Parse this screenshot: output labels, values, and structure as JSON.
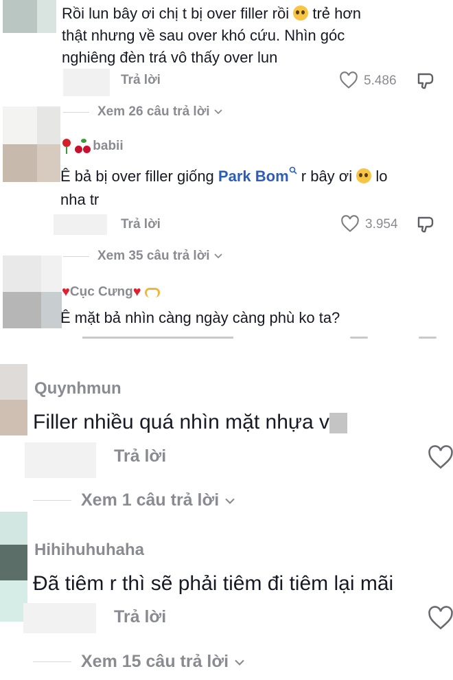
{
  "comments": [
    {
      "text": "Rồi lun bây ơi chị t bị over filler rồi 🥺 trẻ hơn thật nhưng về sau over khó cứu. Nhìn góc nghiêng đèn trá vô thấy over lun",
      "text_lines": [
        "Rồi lun bây ơi chị t bị over filler rồi",
        "trẻ hơn",
        "thật nhưng về sau over khó cứu. Nhìn góc",
        "nghiêng đèn trá vô thấy over lun"
      ],
      "reply_label": "Trả lời",
      "likes": "5.486",
      "view_replies": "Xem 26 câu trả lời"
    },
    {
      "username": "babii",
      "text_before_link": "Ê bả bị over filler giống",
      "link": "Park Bom",
      "text_after_link": "r bây ơi",
      "text_end": "lo",
      "text_line2": "nha tr",
      "reply_label": "Trả lời",
      "likes": "3.954",
      "view_replies": "Xem 35 câu trả lời"
    },
    {
      "username": "Cục Cưng",
      "text": "Ê mặt bả nhìn càng ngày càng phù ko ta?"
    },
    {
      "username": "Quynhmun",
      "text": "Filler nhiều quá nhìn mặt nhựa v",
      "reply_label": "Trả lời",
      "view_replies": "Xem 1 câu trả lời"
    },
    {
      "username": "Hihihuhuhaha",
      "text": "Đã tiêm r thì sẽ phải tiêm đi tiêm lại mãi",
      "reply_label": "Trả lời",
      "view_replies": "Xem 15 câu trả lời"
    }
  ],
  "icons": [
    "heart-icon",
    "dislike-icon",
    "chevron-down-icon",
    "search-icon",
    "pleading-face-emoji",
    "rose-emoji",
    "cherries-emoji",
    "red-heart-emoji",
    "heart-hands-emoji"
  ],
  "colors": {
    "text": "#161823",
    "secondary": "#8a8b91",
    "link": "#2b5db9"
  }
}
